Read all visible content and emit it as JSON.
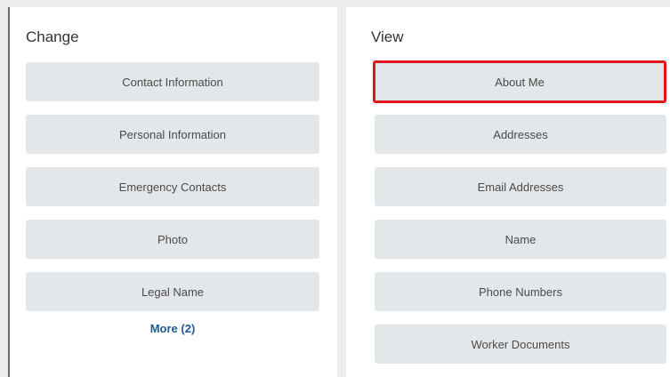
{
  "change": {
    "title": "Change",
    "items": [
      {
        "label": "Contact Information"
      },
      {
        "label": "Personal Information"
      },
      {
        "label": "Emergency Contacts"
      },
      {
        "label": "Photo"
      },
      {
        "label": "Legal Name"
      }
    ],
    "more_label": "More (2)"
  },
  "view": {
    "title": "View",
    "items": [
      {
        "label": "About Me",
        "highlighted": true
      },
      {
        "label": "Addresses"
      },
      {
        "label": "Email Addresses"
      },
      {
        "label": "Name"
      },
      {
        "label": "Phone Numbers"
      },
      {
        "label": "Worker Documents"
      }
    ]
  },
  "colors": {
    "button_bg": "#e4e7ea",
    "link": "#1f5a96",
    "highlight_border": "#e3141d"
  }
}
